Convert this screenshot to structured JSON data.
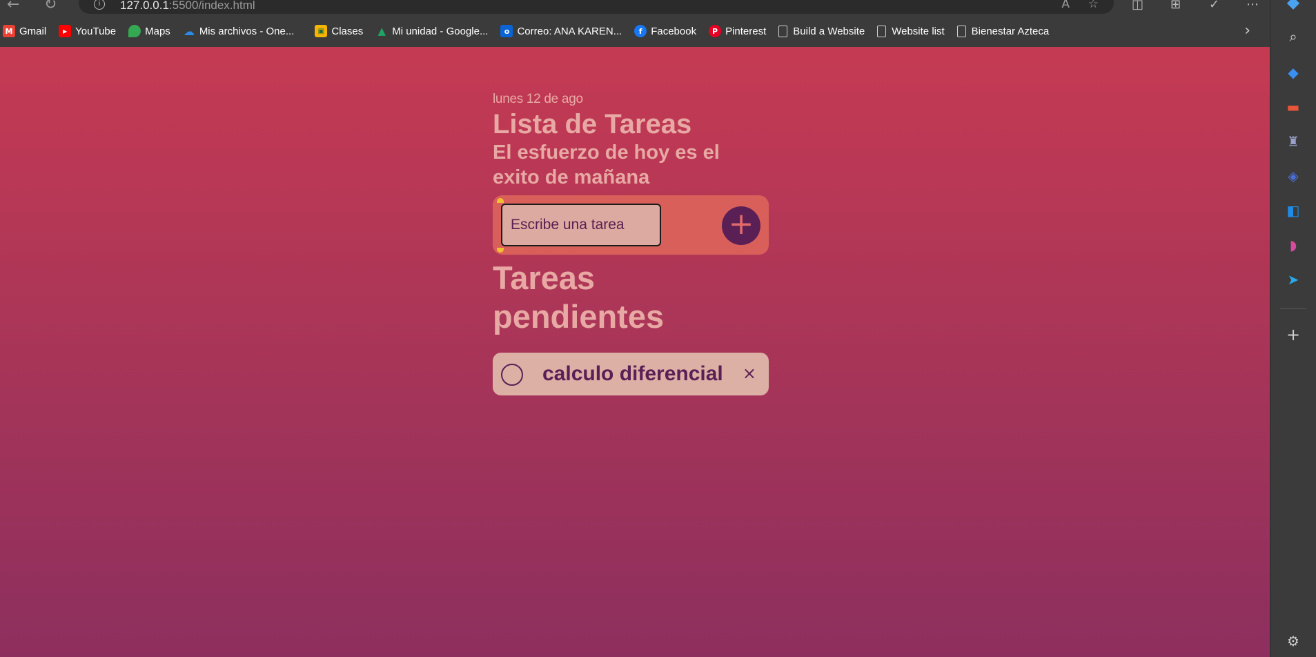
{
  "browser": {
    "url_host": "127.0.0.1",
    "url_rest": ":5500/index.html",
    "bookmarks": [
      {
        "label": "Gmail",
        "icon": "gmail-icon",
        "color": "#ea4335",
        "glyph": "M"
      },
      {
        "label": "YouTube",
        "icon": "youtube-icon",
        "color": "#ff0000",
        "glyph": "▶"
      },
      {
        "label": "Maps",
        "icon": "maps-icon",
        "color": "#34a853",
        "glyph": "◉"
      },
      {
        "label": "Mis archivos - One...",
        "icon": "onedrive-icon",
        "color": "#0a64d6",
        "glyph": "☁"
      },
      {
        "label": "Clases",
        "icon": "classroom-icon",
        "color": "#f4b400",
        "glyph": "▣"
      },
      {
        "label": "Mi unidad - Google...",
        "icon": "drive-icon",
        "color": "#1fa463",
        "glyph": "▲"
      },
      {
        "label": "Correo: ANA KAREN...",
        "icon": "outlook-icon",
        "color": "#0a64d6",
        "glyph": "o"
      },
      {
        "label": "Facebook",
        "icon": "facebook-icon",
        "color": "#1877f2",
        "glyph": "f"
      },
      {
        "label": "Pinterest",
        "icon": "pinterest-icon",
        "color": "#e60023",
        "glyph": "P"
      },
      {
        "label": "Build a Website",
        "icon": "page-icon",
        "color": "",
        "glyph": ""
      },
      {
        "label": "Website list",
        "icon": "page-icon",
        "color": "",
        "glyph": ""
      },
      {
        "label": "Bienestar Azteca",
        "icon": "page-icon",
        "color": "",
        "glyph": ""
      }
    ]
  },
  "app": {
    "date": "lunes 12 de ago",
    "title": "Lista de Tareas",
    "subtitle": "El esfuerzo de hoy es el exito de mañana",
    "input_placeholder": "Escribe una tarea",
    "add_symbol": "+",
    "pending_heading": "Tareas pendientes",
    "tasks": [
      {
        "text": "calculo diferencial",
        "delete_symbol": "×"
      }
    ]
  },
  "colors": {
    "bg_top": "#c53a53",
    "bg_bottom": "#8d2f5e",
    "accent": "#5a1f55",
    "text_light": "#e8a9a4",
    "card": "#dcb0a5"
  }
}
